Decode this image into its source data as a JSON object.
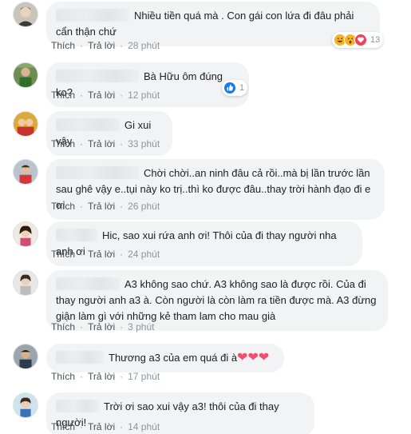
{
  "comments": [
    {
      "text": "Nhiều tiền quá mà . Con gái con lứa đi đâu phải cẩn thận chứ",
      "like": "Thích",
      "reply": "Trả lời",
      "time": "28 phút",
      "reactions": {
        "icons": [
          "haha-icon",
          "wow-icon",
          "love-icon"
        ],
        "count": "13"
      }
    },
    {
      "text": "Bà Hữu ôm đúng ko?",
      "like": "Thích",
      "reply": "Trả lời",
      "time": "12 phút",
      "reactions": {
        "icons": [
          "like-icon"
        ],
        "count": "1"
      }
    },
    {
      "text": "Gi xui vậy",
      "like": "Thích",
      "reply": "Trả lời",
      "time": "33 phút"
    },
    {
      "text": "Chời chời..an ninh đâu cả rồi..mà bị lần trước lần sau ghê vậy e..tụi này ko trị..thì ko được đâu..thay trời hành đạo đi e ơi",
      "like": "Thích",
      "reply": "Trả lời",
      "time": "26 phút"
    },
    {
      "text": "Hic, sao xui rứa anh ơi! Thôi của đi thay người nha anh ơi",
      "like": "Thích",
      "reply": "Trả lời",
      "time": "24 phút"
    },
    {
      "text": "A3 không sao chứ. A3 không sao là được rồi. Của đi thay người anh a3 à. Còn người là còn làm ra tiền được mà. A3 đừng giận làm gì với những kẻ tham lam cho mau già",
      "like": "Thích",
      "reply": "Trả lời",
      "time": "3 phút"
    },
    {
      "text": "Thương a3 của em quá đi à",
      "hearts": "❤❤❤",
      "like": "Thích",
      "reply": "Trả lời",
      "time": "17 phút"
    },
    {
      "text": "Trời ơi sao xui vậy a3! thôi của đi thay người!",
      "like": "Thích",
      "reply": "Trả lời",
      "time": "14 phút"
    }
  ],
  "colors": {
    "bubble": "#f2f3f5",
    "meta": "#90949c",
    "like_blue": "#1877f2",
    "love_red": "#f33e58",
    "haha_yellow": "#f7b125"
  }
}
